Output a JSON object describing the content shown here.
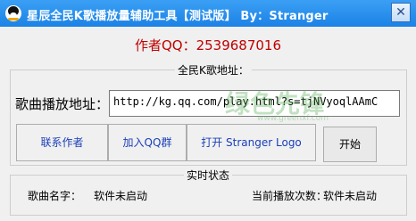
{
  "window": {
    "title": "星辰全民K歌播放量辅助工具【测试版】   By：Stranger",
    "close_glyph": "✕"
  },
  "author": "作者QQ：2539687016",
  "url_group": {
    "legend": "全民K歌地址：",
    "label": "歌曲播放地址：",
    "value": "http://kg.qq.com/play.html?s=tjNVyoqlAAmC"
  },
  "buttons": {
    "contact": "联系作者",
    "join_group": "加入QQ群",
    "open_logo": "打开 Stranger Logo",
    "start": "开始"
  },
  "status_group": {
    "legend": "实时状态",
    "song_label": "歌曲名字：",
    "song_value": "软件未启动",
    "count_label": "当前播放次数：",
    "count_value": "软件未启动"
  },
  "watermark": {
    "text": "绿色先锋",
    "sub": "www.greenxf.com"
  }
}
